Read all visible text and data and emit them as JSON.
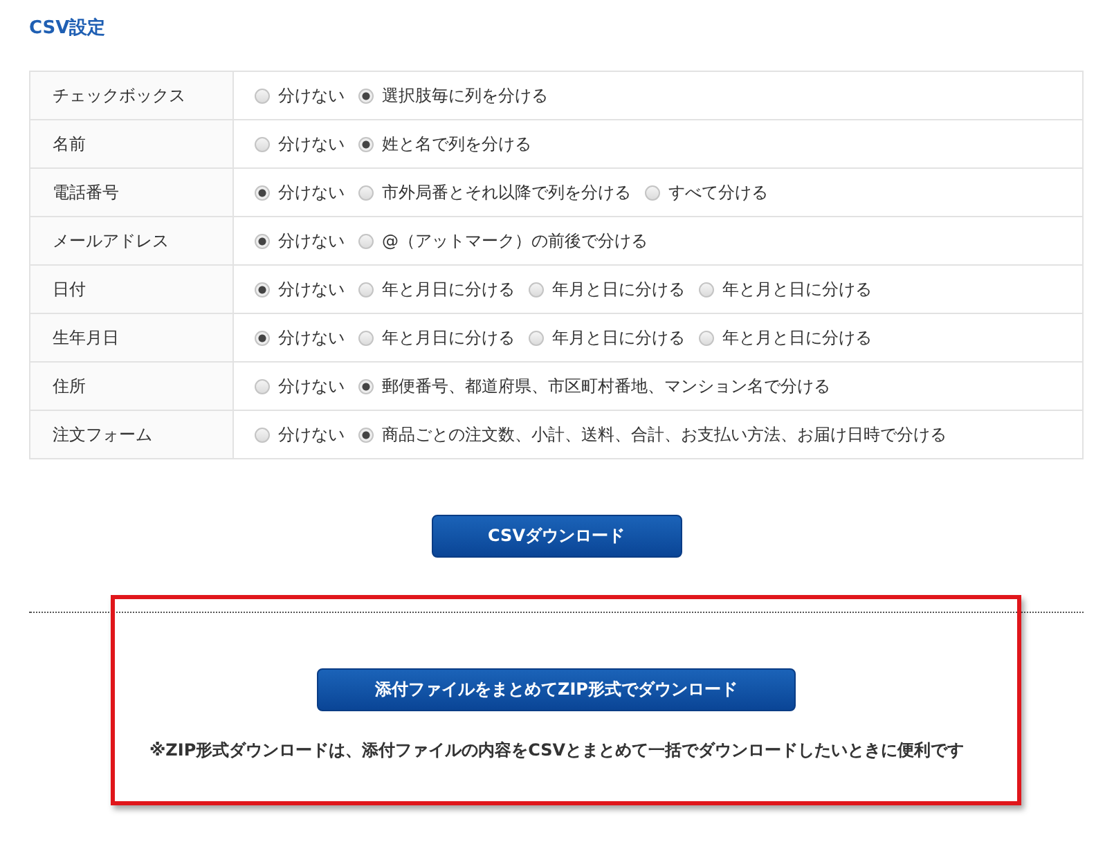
{
  "heading": "CSV設定",
  "settings": [
    {
      "label": "チェックボックス",
      "options": [
        {
          "label": "分けない",
          "selected": false
        },
        {
          "label": "選択肢毎に列を分ける",
          "selected": true
        }
      ]
    },
    {
      "label": "名前",
      "options": [
        {
          "label": "分けない",
          "selected": false
        },
        {
          "label": "姓と名で列を分ける",
          "selected": true
        }
      ]
    },
    {
      "label": "電話番号",
      "options": [
        {
          "label": "分けない",
          "selected": true
        },
        {
          "label": "市外局番とそれ以降で列を分ける",
          "selected": false
        },
        {
          "label": "すべて分ける",
          "selected": false
        }
      ]
    },
    {
      "label": "メールアドレス",
      "options": [
        {
          "label": "分けない",
          "selected": true
        },
        {
          "label": "@（アットマーク）の前後で分ける",
          "selected": false
        }
      ]
    },
    {
      "label": "日付",
      "options": [
        {
          "label": "分けない",
          "selected": true
        },
        {
          "label": "年と月日に分ける",
          "selected": false
        },
        {
          "label": "年月と日に分ける",
          "selected": false
        },
        {
          "label": "年と月と日に分ける",
          "selected": false
        }
      ]
    },
    {
      "label": "生年月日",
      "options": [
        {
          "label": "分けない",
          "selected": true
        },
        {
          "label": "年と月日に分ける",
          "selected": false
        },
        {
          "label": "年月と日に分ける",
          "selected": false
        },
        {
          "label": "年と月と日に分ける",
          "selected": false
        }
      ]
    },
    {
      "label": "住所",
      "options": [
        {
          "label": "分けない",
          "selected": false
        },
        {
          "label": "郵便番号、都道府県、市区町村番地、マンション名で分ける",
          "selected": true
        }
      ]
    },
    {
      "label": "注文フォーム",
      "options": [
        {
          "label": "分けない",
          "selected": false
        },
        {
          "label": "商品ごとの注文数、小計、送料、合計、お支払い方法、お届け日時で分ける",
          "selected": true
        }
      ]
    }
  ],
  "csv_button": "CSVダウンロード",
  "zip_button": "添付ファイルをまとめてZIP形式でダウンロード",
  "zip_note": "※ZIP形式ダウンロードは、添付ファイルの内容をCSVとまとめて一括でダウンロードしたいときに便利です"
}
